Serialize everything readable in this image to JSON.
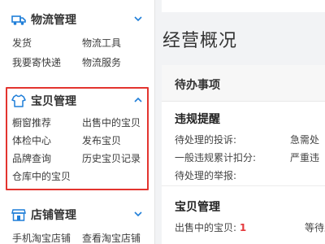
{
  "sidebar": {
    "logistics": {
      "title": "物流管理",
      "links": [
        "发货",
        "物流工具",
        "我要寄快递",
        "物流服务"
      ]
    },
    "products": {
      "title": "宝贝管理",
      "links": [
        "橱窗推荐",
        "出售中的宝贝",
        "体检中心",
        "发布宝贝",
        "品牌查询",
        "历史宝贝记录",
        "仓库中的宝贝"
      ]
    },
    "shop": {
      "title": "店铺管理",
      "links": [
        "手机淘宝店铺",
        "查看淘宝店铺"
      ]
    }
  },
  "main": {
    "title": "经营概况",
    "todo": {
      "title": "待办事项",
      "violation": {
        "title": "违规提醒",
        "items": [
          "待处理的投诉:",
          "急需处",
          "一般违规累计扣分:",
          "严重违",
          "待处理的举报:"
        ]
      },
      "products": {
        "title": "宝贝管理",
        "on_sale_label": "出售中的宝贝:",
        "on_sale_count": "1",
        "waiting_label": "等待上"
      }
    }
  },
  "colors": {
    "accent_blue": "#1f7ed8",
    "highlight_red": "#e3342f",
    "count_red": "#e4393c"
  }
}
